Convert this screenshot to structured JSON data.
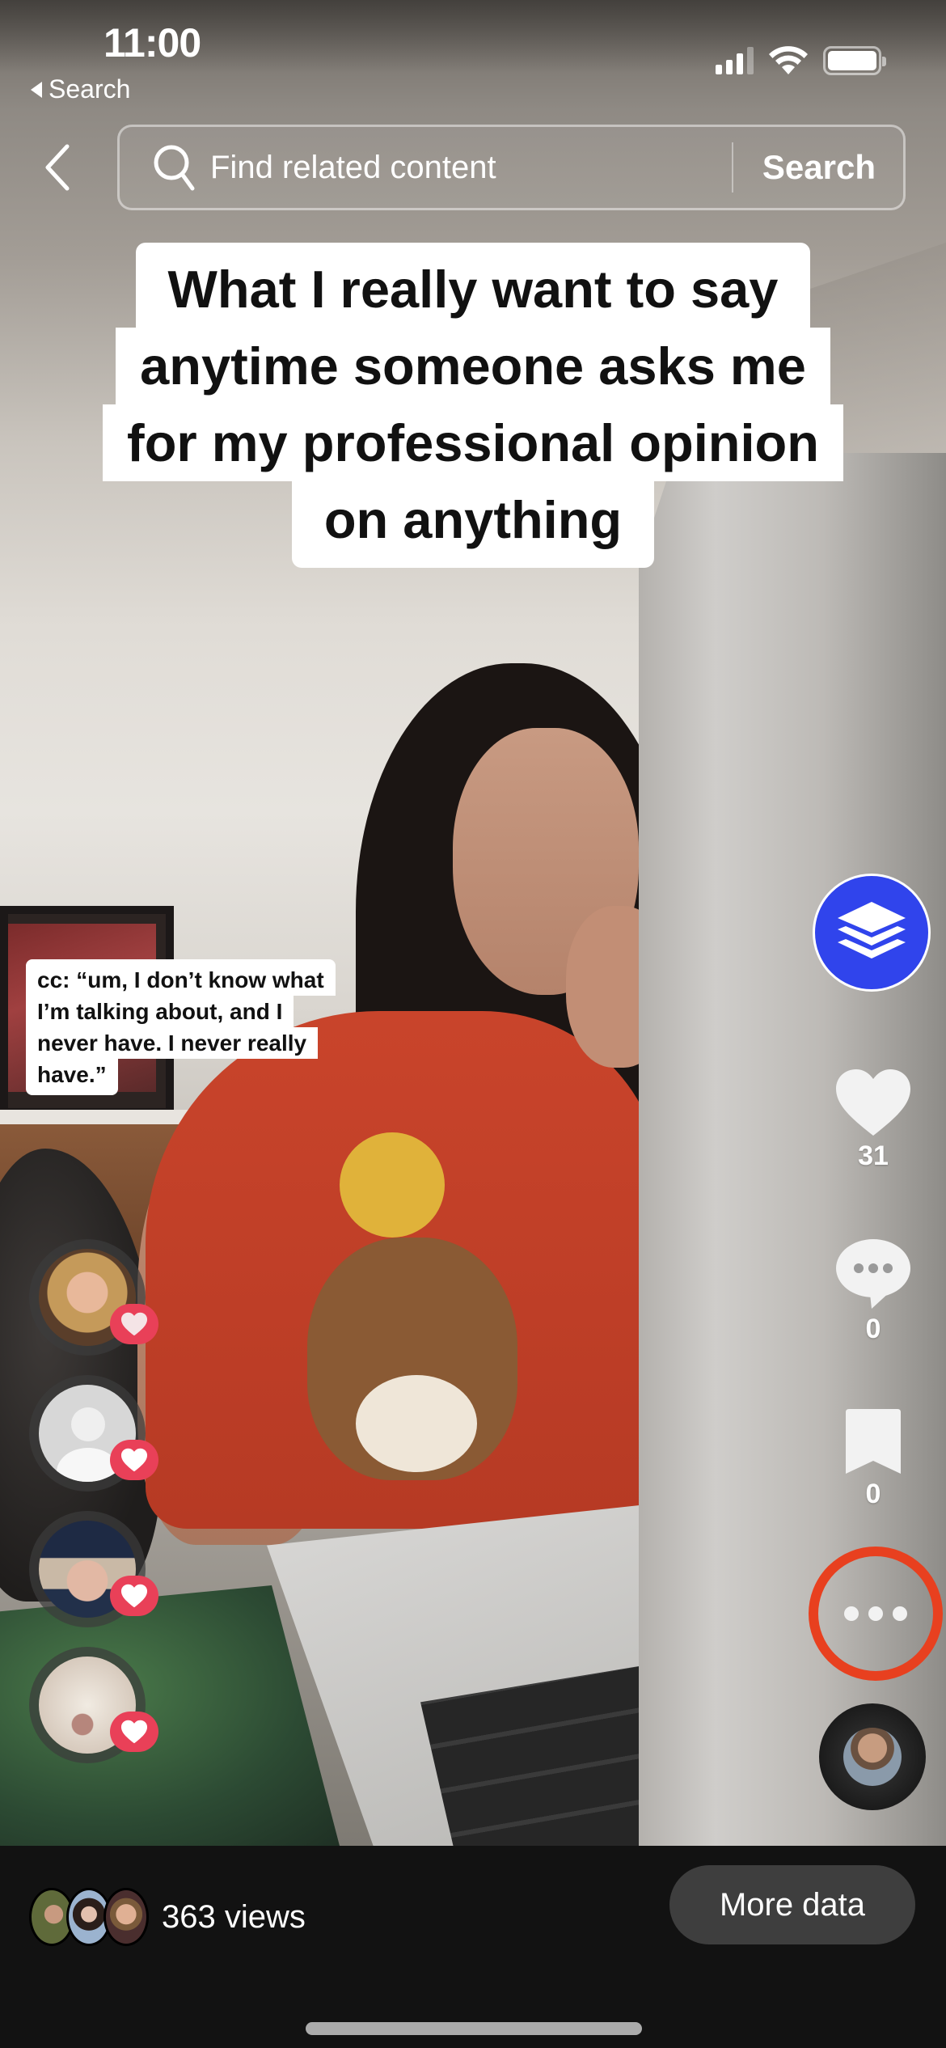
{
  "status_bar": {
    "time": "11:00",
    "back_app_label": "Search",
    "signal_bars": 3,
    "signal_max": 4,
    "wifi": true,
    "battery_percent": 100
  },
  "header": {
    "back_icon": "chevron-left-icon",
    "search_placeholder": "Find related content",
    "search_value": "",
    "search_button_label": "Search",
    "search_icon": "search-icon"
  },
  "video": {
    "overlay_caption": [
      "What I really want to say",
      "anytime someone asks me",
      "for my professional opinion",
      "on anything"
    ],
    "cc_caption": [
      "cc: “um, I don’t know what",
      "I’m talking about, and I",
      "never have. I never really",
      "have.”"
    ]
  },
  "actions": {
    "layers_icon": "layers-icon",
    "likes": {
      "icon": "heart-icon",
      "count": "31"
    },
    "comments": {
      "icon": "comment-icon",
      "count": "0"
    },
    "bookmarks": {
      "icon": "bookmark-icon",
      "count": "0"
    },
    "more": {
      "icon": "more-dots-icon",
      "highlight_color": "#e8401f"
    },
    "sound_disc": {
      "icon": "music-disc-icon"
    },
    "accent_color": "#3044ec",
    "like_badge_color": "#e94058"
  },
  "likers": [
    {
      "name": "liker-1",
      "icon": "heart-icon"
    },
    {
      "name": "liker-2-default-avatar",
      "icon": "heart-icon"
    },
    {
      "name": "liker-3",
      "icon": "heart-icon"
    },
    {
      "name": "liker-4",
      "icon": "heart-icon"
    }
  ],
  "footer": {
    "views_label": "363 views",
    "viewer_avatar_count": 3,
    "more_data_label": "More data"
  }
}
